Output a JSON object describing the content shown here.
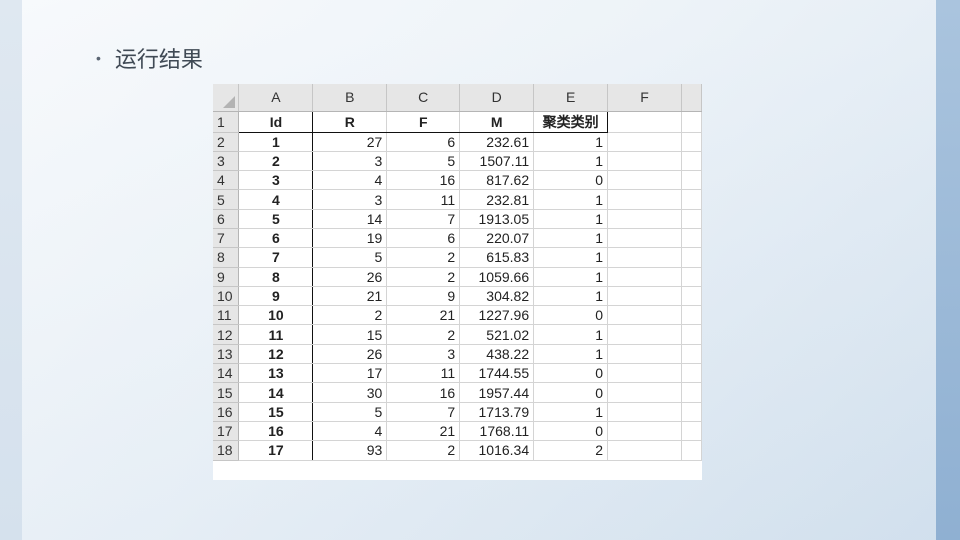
{
  "slide": {
    "bullet_text": "运行结果"
  },
  "spreadsheet": {
    "column_letters": [
      "A",
      "B",
      "C",
      "D",
      "E",
      "F"
    ],
    "header_row_number": "1",
    "headers": [
      "Id",
      "R",
      "F",
      "M",
      "聚类类别"
    ],
    "rows": [
      {
        "row": "2",
        "id": "1",
        "r": "27",
        "f": "6",
        "m": "232.61",
        "cat": "1"
      },
      {
        "row": "3",
        "id": "2",
        "r": "3",
        "f": "5",
        "m": "1507.11",
        "cat": "1"
      },
      {
        "row": "4",
        "id": "3",
        "r": "4",
        "f": "16",
        "m": "817.62",
        "cat": "0"
      },
      {
        "row": "5",
        "id": "4",
        "r": "3",
        "f": "11",
        "m": "232.81",
        "cat": "1"
      },
      {
        "row": "6",
        "id": "5",
        "r": "14",
        "f": "7",
        "m": "1913.05",
        "cat": "1"
      },
      {
        "row": "7",
        "id": "6",
        "r": "19",
        "f": "6",
        "m": "220.07",
        "cat": "1"
      },
      {
        "row": "8",
        "id": "7",
        "r": "5",
        "f": "2",
        "m": "615.83",
        "cat": "1"
      },
      {
        "row": "9",
        "id": "8",
        "r": "26",
        "f": "2",
        "m": "1059.66",
        "cat": "1"
      },
      {
        "row": "10",
        "id": "9",
        "r": "21",
        "f": "9",
        "m": "304.82",
        "cat": "1"
      },
      {
        "row": "11",
        "id": "10",
        "r": "2",
        "f": "21",
        "m": "1227.96",
        "cat": "0"
      },
      {
        "row": "12",
        "id": "11",
        "r": "15",
        "f": "2",
        "m": "521.02",
        "cat": "1"
      },
      {
        "row": "13",
        "id": "12",
        "r": "26",
        "f": "3",
        "m": "438.22",
        "cat": "1"
      },
      {
        "row": "14",
        "id": "13",
        "r": "17",
        "f": "11",
        "m": "1744.55",
        "cat": "0"
      },
      {
        "row": "15",
        "id": "14",
        "r": "30",
        "f": "16",
        "m": "1957.44",
        "cat": "0"
      },
      {
        "row": "16",
        "id": "15",
        "r": "5",
        "f": "7",
        "m": "1713.79",
        "cat": "1"
      },
      {
        "row": "17",
        "id": "16",
        "r": "4",
        "f": "21",
        "m": "1768.11",
        "cat": "0"
      },
      {
        "row": "18",
        "id": "17",
        "r": "93",
        "f": "2",
        "m": "1016.34",
        "cat": "2"
      }
    ]
  }
}
